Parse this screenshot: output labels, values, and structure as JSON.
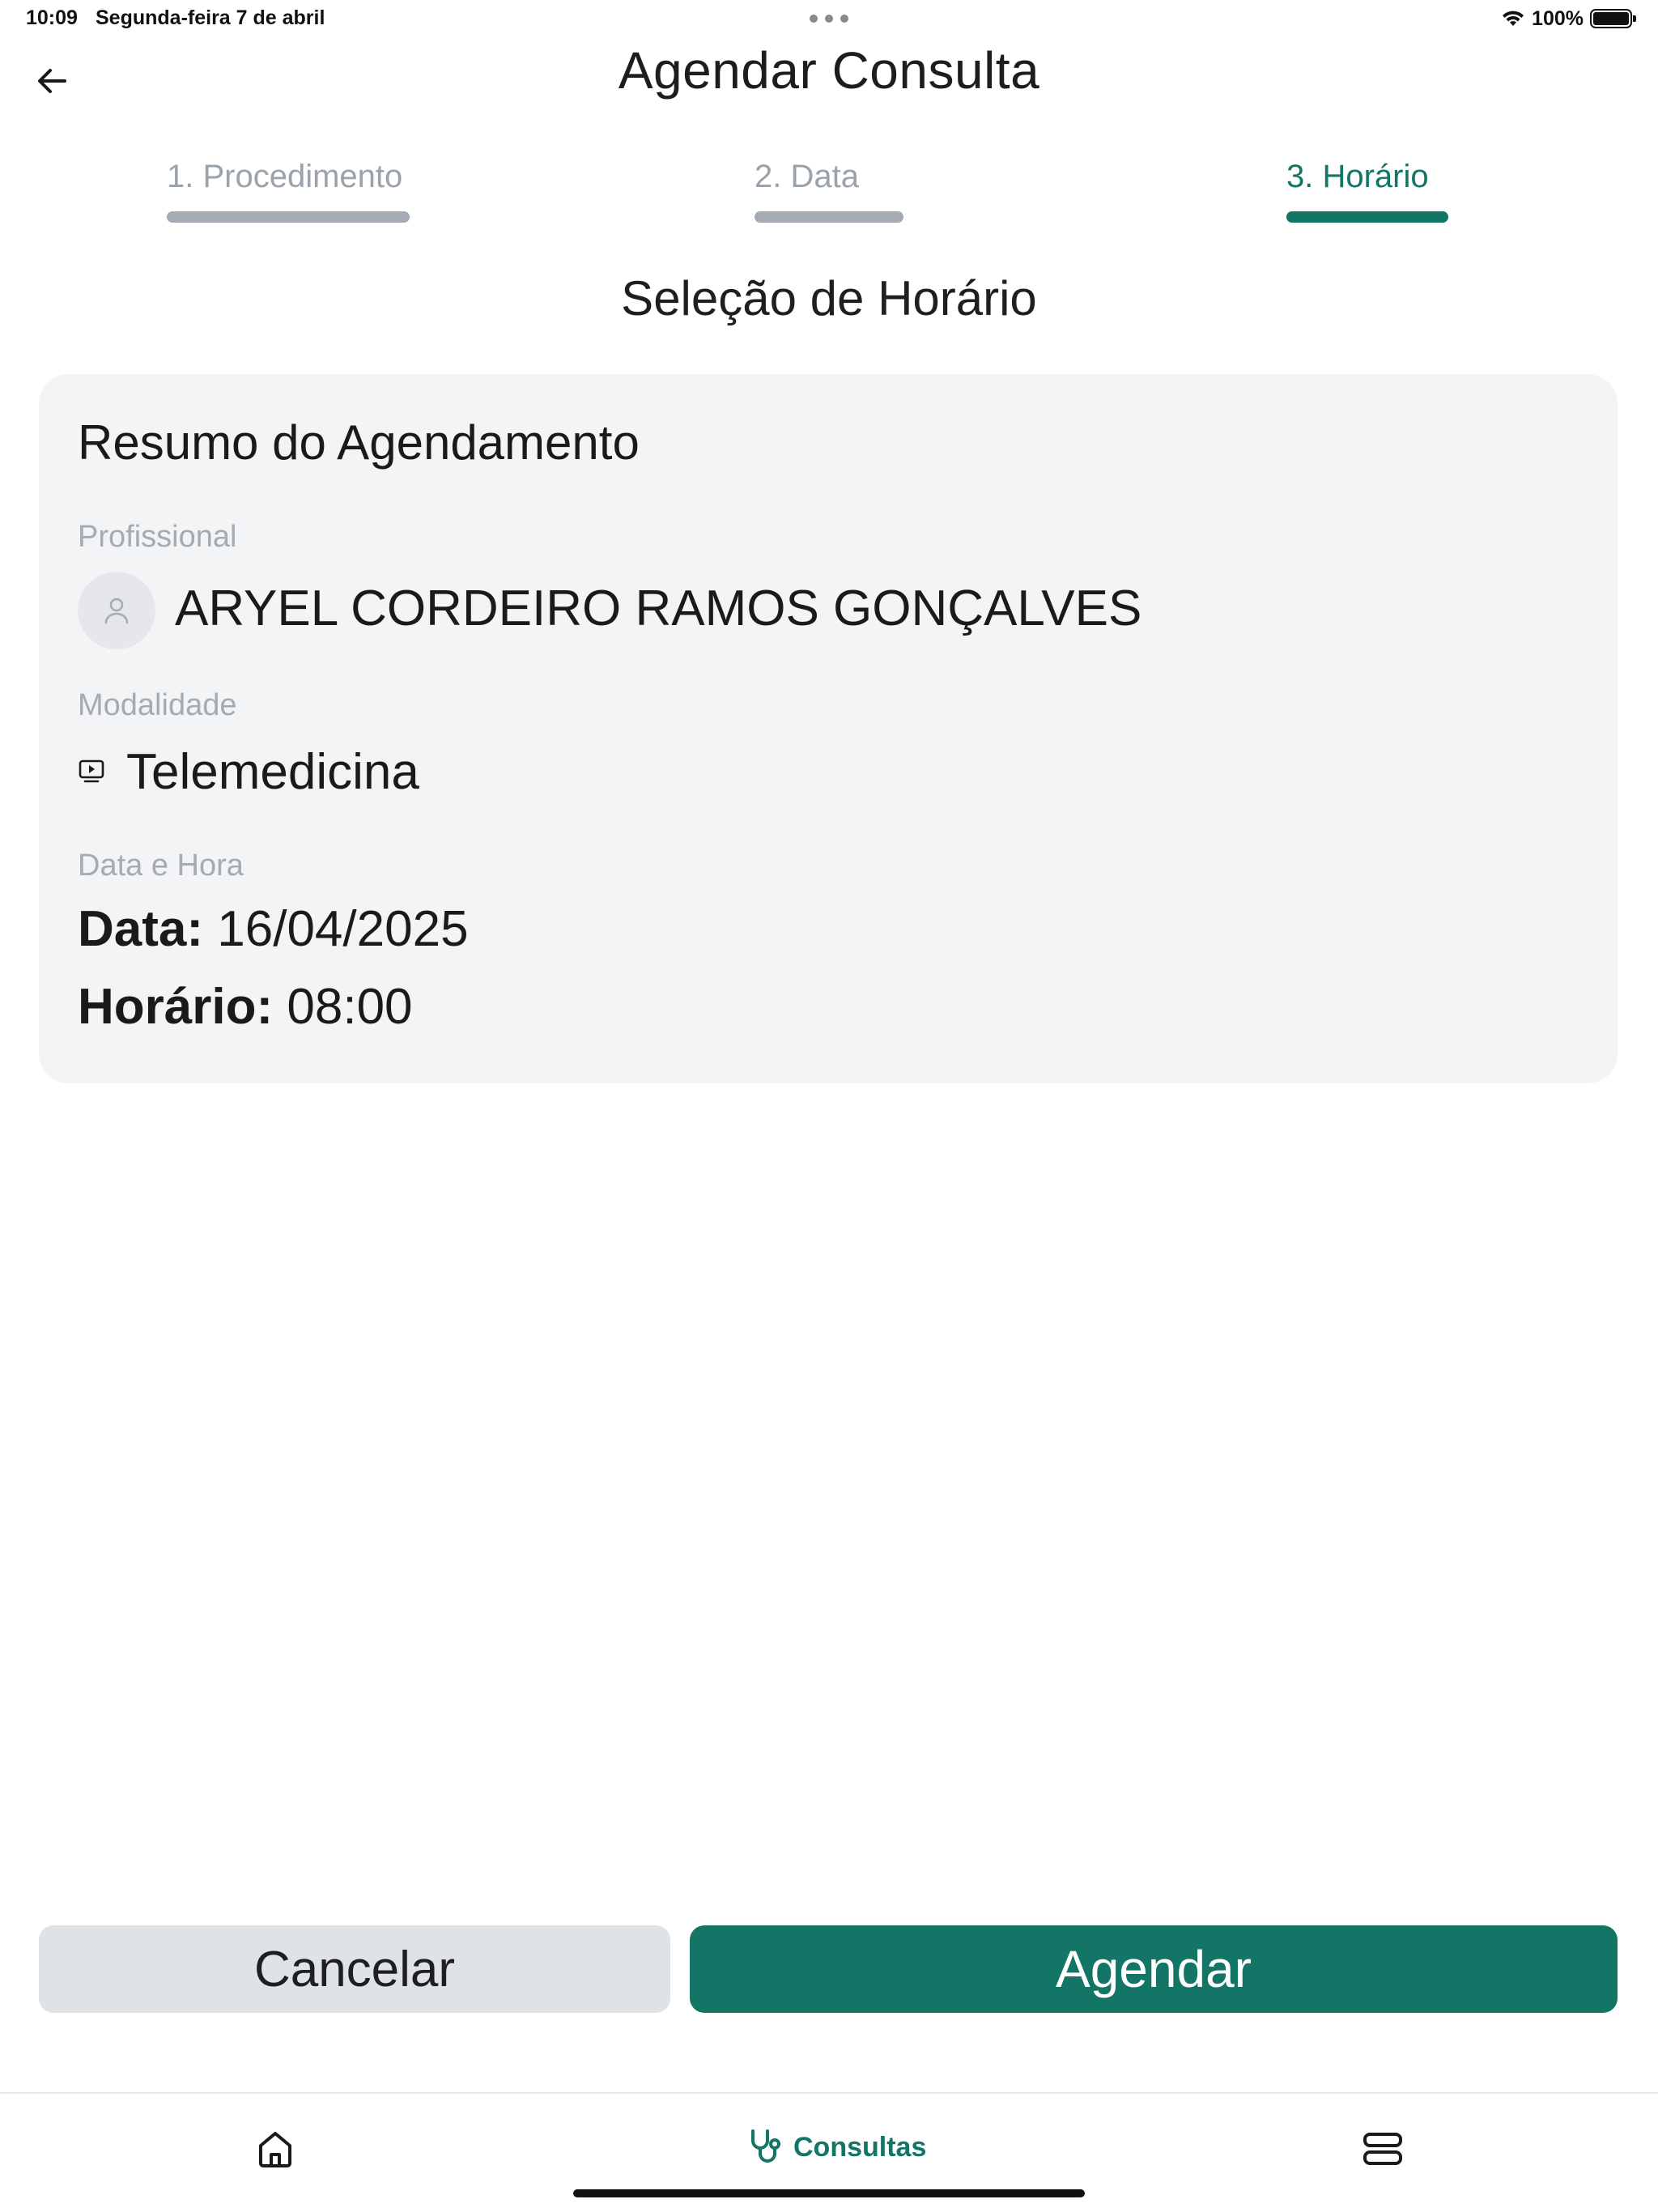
{
  "status_bar": {
    "time": "10:09",
    "date": "Segunda-feira 7 de abril",
    "battery": "100%"
  },
  "header": {
    "title": "Agendar Consulta",
    "back_icon": "arrow-left-icon"
  },
  "steps": [
    {
      "label": "1. Procedimento",
      "active": false
    },
    {
      "label": "2. Data",
      "active": false
    },
    {
      "label": "3. Horário",
      "active": true
    }
  ],
  "section_title": "Seleção de Horário",
  "summary": {
    "title": "Resumo do Agendamento",
    "professional_label": "Profissional",
    "professional_name": "ARYEL CORDEIRO RAMOS GONÇALVES",
    "modality_label": "Modalidade",
    "modality_value": "Telemedicina",
    "datetime_label": "Data e Hora",
    "date_key": "Data:",
    "date_value": "16/04/2025",
    "time_key": "Horário:",
    "time_value": "08:00"
  },
  "actions": {
    "cancel_label": "Cancelar",
    "confirm_label": "Agendar"
  },
  "bottom_nav": {
    "home_icon": "home-icon",
    "consultas_label": "Consultas",
    "consultas_icon": "stethoscope-icon",
    "menu_icon": "menu-icon"
  },
  "colors": {
    "accent": "#137565",
    "inactive_step": "#a4abb3",
    "card_bg": "#f3f4f6",
    "cancel_bg": "#dfe2e6"
  }
}
